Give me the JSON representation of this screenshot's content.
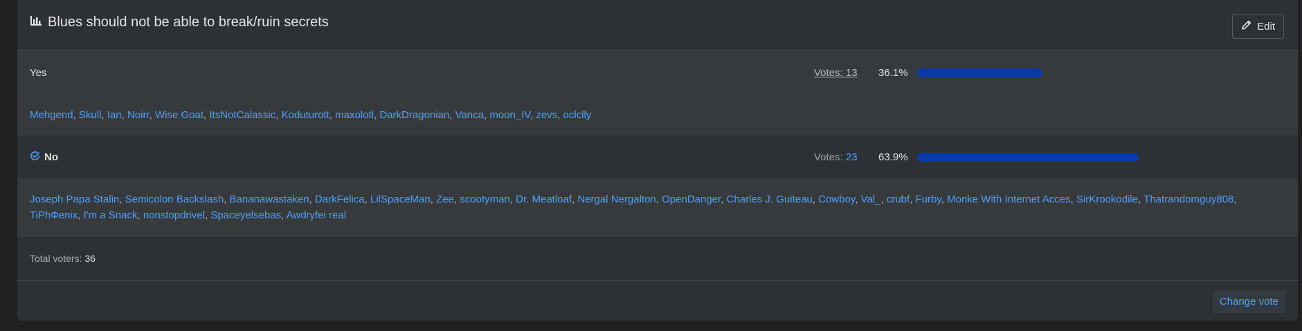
{
  "poll": {
    "title": "Blues should not be able to break/ruin secrets",
    "edit_label": "Edit",
    "title_icon": "bar-chart-icon"
  },
  "options": [
    {
      "label": "Yes",
      "votes_prefix": "Votes: ",
      "votes": "13",
      "percent": "36.1%",
      "percent_value": 36.1,
      "selected": false,
      "voters": [
        "Mehgend",
        "Skull",
        "Ian",
        "Noirr",
        "Wise Goat",
        "ItsNotCalassic",
        "Koduturott",
        "maxolotl",
        "DarkDragonian",
        "Vanca",
        "moon_IV",
        "zevs",
        "oclclly"
      ]
    },
    {
      "label": "No",
      "votes_prefix": "Votes: ",
      "votes": "23",
      "percent": "63.9%",
      "percent_value": 63.9,
      "selected": true,
      "voters": [
        "Joseph Papa Stalin",
        "Semicolon Backslash",
        "Bananawastaken",
        "DarkFelica",
        "LilSpaceMan",
        "Zee",
        "scootyman",
        "Dr. Meatloaf",
        "Nergal Nergalton",
        "OpenDanger",
        "Charles J. Guiteau",
        "Cowboy",
        "Val_",
        "crubf",
        "Furby",
        "Monke With Internet Acces",
        "SirKrookodile",
        "Thatrandomguy808",
        "TiPhФenix",
        "I'm a Snack",
        "nonstopdrivel",
        "Spaceyelsebas",
        "Awdryfei real"
      ]
    }
  ],
  "total": {
    "label": "Total voters: ",
    "count": "36"
  },
  "change_vote_label": "Change vote",
  "colors": {
    "bar": "#0a3aa8",
    "link": "#4fa0ff"
  }
}
